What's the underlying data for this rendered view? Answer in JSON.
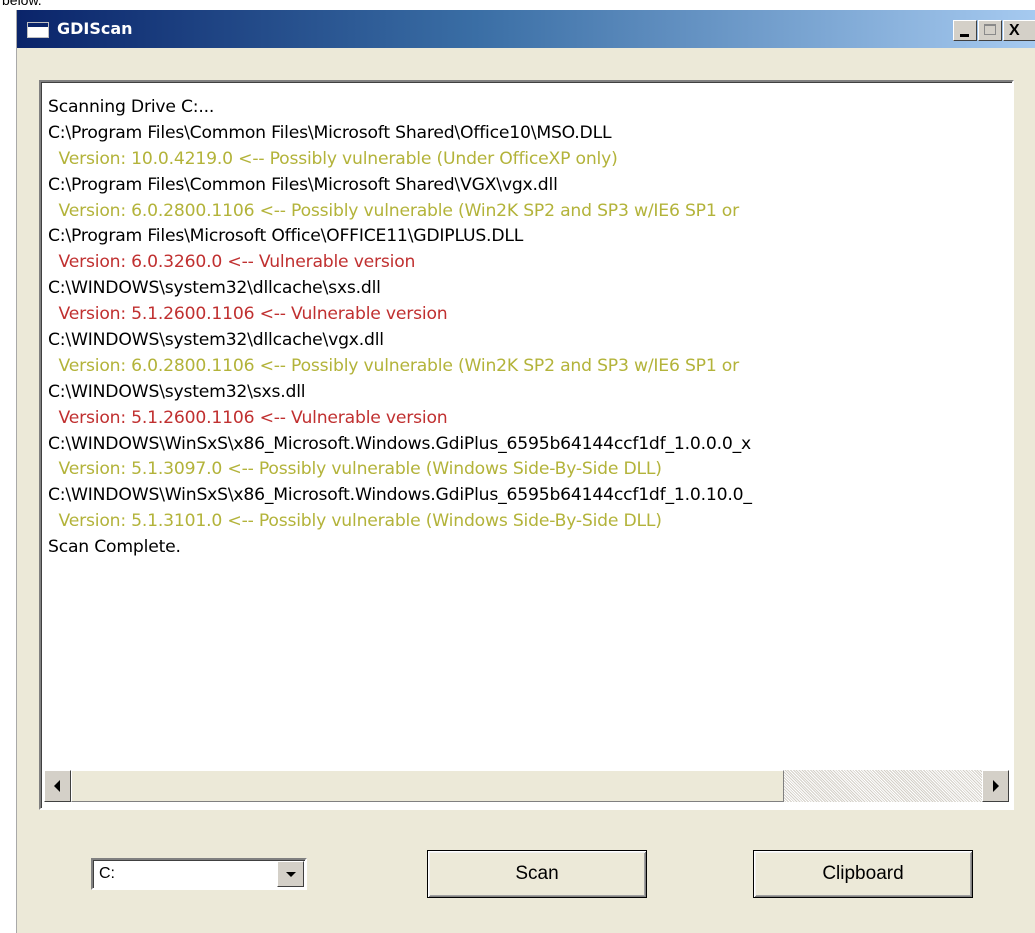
{
  "caption": {
    "text": "below."
  },
  "window": {
    "title": "GDIScan",
    "controls": {
      "close_label": "X"
    }
  },
  "output": {
    "lines": [
      {
        "text": "Scanning Drive C:...",
        "kind": "normal"
      },
      {
        "text": "C:\\Program Files\\Common Files\\Microsoft Shared\\Office10\\MSO.DLL",
        "kind": "normal"
      },
      {
        "text": "  Version: 10.0.4219.0 <-- Possibly vulnerable (Under OfficeXP only)",
        "kind": "warn"
      },
      {
        "text": "C:\\Program Files\\Common Files\\Microsoft Shared\\VGX\\vgx.dll",
        "kind": "normal"
      },
      {
        "text": "  Version: 6.0.2800.1106 <-- Possibly vulnerable (Win2K SP2 and SP3 w/IE6 SP1 or",
        "kind": "warn"
      },
      {
        "text": "C:\\Program Files\\Microsoft Office\\OFFICE11\\GDIPLUS.DLL",
        "kind": "normal"
      },
      {
        "text": "  Version: 6.0.3260.0 <-- Vulnerable version",
        "kind": "vuln"
      },
      {
        "text": "C:\\WINDOWS\\system32\\dllcache\\sxs.dll",
        "kind": "normal"
      },
      {
        "text": "  Version: 5.1.2600.1106 <-- Vulnerable version",
        "kind": "vuln"
      },
      {
        "text": "C:\\WINDOWS\\system32\\dllcache\\vgx.dll",
        "kind": "normal"
      },
      {
        "text": "  Version: 6.0.2800.1106 <-- Possibly vulnerable (Win2K SP2 and SP3 w/IE6 SP1 or",
        "kind": "warn"
      },
      {
        "text": "C:\\WINDOWS\\system32\\sxs.dll",
        "kind": "normal"
      },
      {
        "text": "  Version: 5.1.2600.1106 <-- Vulnerable version",
        "kind": "vuln"
      },
      {
        "text": "C:\\WINDOWS\\WinSxS\\x86_Microsoft.Windows.GdiPlus_6595b64144ccf1df_1.0.0.0_x",
        "kind": "normal"
      },
      {
        "text": "  Version: 5.1.3097.0 <-- Possibly vulnerable (Windows Side-By-Side DLL)",
        "kind": "warn"
      },
      {
        "text": "C:\\WINDOWS\\WinSxS\\x86_Microsoft.Windows.GdiPlus_6595b64144ccf1df_1.0.10.0_",
        "kind": "normal"
      },
      {
        "text": "  Version: 5.1.3101.0 <-- Possibly vulnerable (Windows Side-By-Side DLL)",
        "kind": "warn"
      },
      {
        "text": "Scan Complete.",
        "kind": "normal"
      }
    ]
  },
  "colors": {
    "normal": "#000000",
    "warn": "#b3b33a",
    "vuln": "#c03030",
    "titlebar_start": "#0a246a",
    "titlebar_end": "#a6caf0",
    "face": "#ece9d8"
  },
  "scrollbar": {
    "position_fraction": 0.0
  },
  "controls": {
    "drive_value": "C:",
    "scan_label": "Scan",
    "clipboard_label": "Clipboard"
  },
  "icons": {
    "app": "app-window-icon",
    "minimize": "minimize-icon",
    "maximize": "maximize-icon",
    "close": "close-icon",
    "scroll_left": "arrow-left-icon",
    "scroll_right": "arrow-right-icon",
    "dropdown": "chevron-down-icon"
  }
}
